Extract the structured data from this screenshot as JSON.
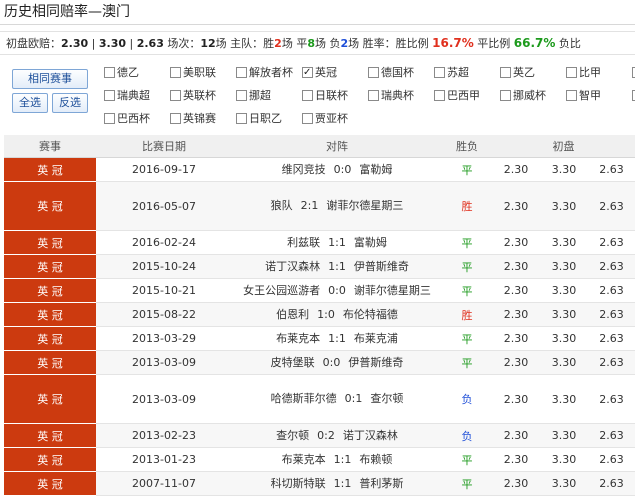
{
  "title": "历史相同赔率—澳门",
  "stats": {
    "label": "初盘欧赔：",
    "odds": [
      "2.30",
      "3.30",
      "2.63"
    ],
    "sep": "|",
    "count_label": "场次：",
    "count": "12",
    "count_unit": "场",
    "home_label": "主队：胜",
    "win": "2",
    "win_unit": "场 平",
    "draw": "8",
    "draw_unit": "场 负",
    "loss": "2",
    "loss_unit": "场",
    "rate_label": "胜率：胜比例",
    "win_pct": "16.7%",
    "draw_pct_label": "平比例",
    "draw_pct": "66.7%",
    "loss_pct_label": "负比"
  },
  "filter": {
    "buttons": {
      "same_match": "相同赛事",
      "select_all": "全选",
      "invert": "反选"
    },
    "leagues": [
      {
        "name": "德乙",
        "checked": false
      },
      {
        "name": "美职联",
        "checked": false
      },
      {
        "name": "解放者杯",
        "checked": false
      },
      {
        "name": "英冠",
        "checked": true
      },
      {
        "name": "德国杯",
        "checked": false
      },
      {
        "name": "苏超",
        "checked": false
      },
      {
        "name": "英乙",
        "checked": false
      },
      {
        "name": "比甲",
        "checked": false
      },
      {
        "name": "",
        "checked": false
      },
      {
        "name": "瑞典超",
        "checked": false
      },
      {
        "name": "英联杯",
        "checked": false
      },
      {
        "name": "挪超",
        "checked": false
      },
      {
        "name": "日联杯",
        "checked": false
      },
      {
        "name": "瑞典杯",
        "checked": false
      },
      {
        "name": "巴西甲",
        "checked": false
      },
      {
        "name": "挪威杯",
        "checked": false
      },
      {
        "name": "智甲",
        "checked": false
      },
      {
        "name": "",
        "checked": false
      },
      {
        "name": "巴西杯",
        "checked": false
      },
      {
        "name": "英锦赛",
        "checked": false
      },
      {
        "name": "日职乙",
        "checked": false
      },
      {
        "name": "贾亚杯",
        "checked": false
      }
    ]
  },
  "table": {
    "headers": [
      "赛事",
      "比赛日期",
      "对阵",
      "胜负",
      "初盘",
      "",
      ""
    ],
    "rows": [
      {
        "league": "英  冠",
        "date": "2016-09-17",
        "home": "维冈竞技",
        "score": "0:0",
        "away": "富勒姆",
        "result": "平"
      },
      {
        "league": "英  冠",
        "date": "2016-05-07",
        "home": "狼队",
        "score": "2:1",
        "away": "谢菲尔德星期三",
        "result": "胜"
      },
      {
        "league": "英  冠",
        "date": "2016-02-24",
        "home": "利兹联",
        "score": "1:1",
        "away": "富勒姆",
        "result": "平"
      },
      {
        "league": "英  冠",
        "date": "2015-10-24",
        "home": "诺丁汉森林",
        "score": "1:1",
        "away": "伊普斯维奇",
        "result": "平"
      },
      {
        "league": "英  冠",
        "date": "2015-10-21",
        "home": "女王公园巡游者",
        "score": "0:0",
        "away": "谢菲尔德星期三",
        "result": "平"
      },
      {
        "league": "英  冠",
        "date": "2015-08-22",
        "home": "伯恩利",
        "score": "1:0",
        "away": "布伦特福德",
        "result": "胜"
      },
      {
        "league": "英  冠",
        "date": "2013-03-29",
        "home": "布莱克本",
        "score": "1:1",
        "away": "布莱克浦",
        "result": "平"
      },
      {
        "league": "英  冠",
        "date": "2013-03-09",
        "home": "皮特堡联",
        "score": "0:0",
        "away": "伊普斯维奇",
        "result": "平"
      },
      {
        "league": "英  冠",
        "date": "2013-03-09",
        "home": "哈德斯菲尔德",
        "score": "0:1",
        "away": "查尔顿",
        "result": "负"
      },
      {
        "league": "英  冠",
        "date": "2013-02-23",
        "home": "查尔顿",
        "score": "0:2",
        "away": "诺丁汉森林",
        "result": "负"
      },
      {
        "league": "英  冠",
        "date": "2013-01-23",
        "home": "布莱克本",
        "score": "1:1",
        "away": "布赖顿",
        "result": "平"
      },
      {
        "league": "英  冠",
        "date": "2007-11-07",
        "home": "科切斯特联",
        "score": "1:1",
        "away": "普利茅斯",
        "result": "平"
      }
    ],
    "odds": [
      "2.30",
      "3.30",
      "2.63"
    ]
  }
}
